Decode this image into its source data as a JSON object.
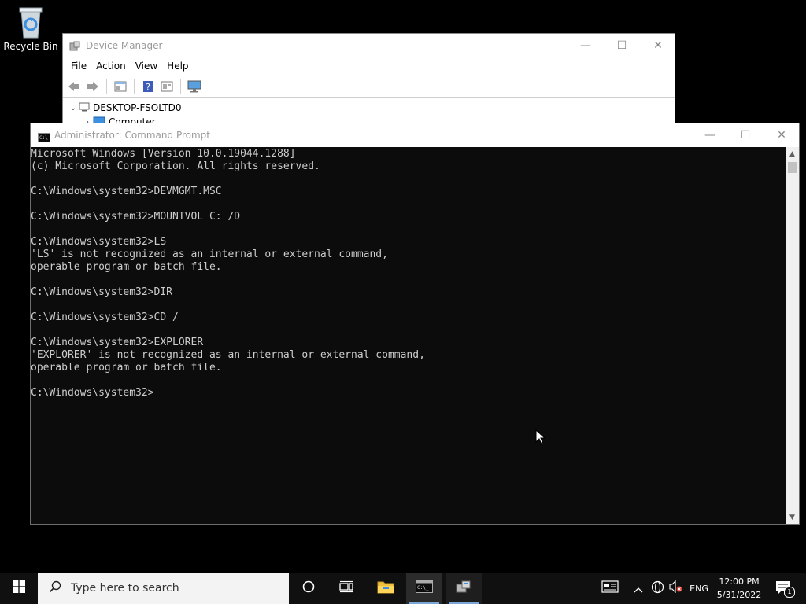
{
  "desktop": {
    "icons": [
      {
        "label": "Recycle Bin",
        "icon": "recycle-bin-icon"
      }
    ]
  },
  "device_manager": {
    "title": "Device Manager",
    "menu": [
      "File",
      "Action",
      "View",
      "Help"
    ],
    "toolbar_icons": [
      "back-arrow-icon",
      "forward-arrow-icon",
      "show-hide-console-tree-icon",
      "help-icon",
      "properties-icon",
      "scan-hardware-icon"
    ],
    "tree": [
      {
        "label": "DESKTOP-FSOLTD0",
        "expanded": true
      },
      {
        "label": "Computer",
        "expanded": false
      }
    ]
  },
  "command_prompt": {
    "title": "Administrator: Command Prompt",
    "lines": [
      "Microsoft Windows [Version 10.0.19044.1288]",
      "(c) Microsoft Corporation. All rights reserved.",
      "",
      "C:\\Windows\\system32>DEVMGMT.MSC",
      "",
      "C:\\Windows\\system32>MOUNTVOL C: /D",
      "",
      "C:\\Windows\\system32>LS",
      "'LS' is not recognized as an internal or external command,",
      "operable program or batch file.",
      "",
      "C:\\Windows\\system32>DIR",
      "",
      "C:\\Windows\\system32>CD /",
      "",
      "C:\\Windows\\system32>EXPLORER",
      "'EXPLORER' is not recognized as an internal or external command,",
      "operable program or batch file.",
      "",
      "C:\\Windows\\system32>"
    ]
  },
  "window_controls": {
    "minimize": "—",
    "maximize": "☐",
    "close": "✕"
  },
  "taskbar": {
    "search_placeholder": "Type here to search",
    "pinned": [
      "cortana-icon",
      "task-view-icon",
      "file-explorer-icon",
      "command-prompt-icon",
      "device-manager-icon"
    ],
    "tray": {
      "language": "ENG",
      "time": "12:00 PM",
      "date": "5/31/2022",
      "notifications_count": "1"
    }
  },
  "colors": {
    "console_bg": "#0c0c0c",
    "console_text": "#cccccc",
    "taskbar_bg": "#101010",
    "active_indicator": "#7aa7d6"
  }
}
